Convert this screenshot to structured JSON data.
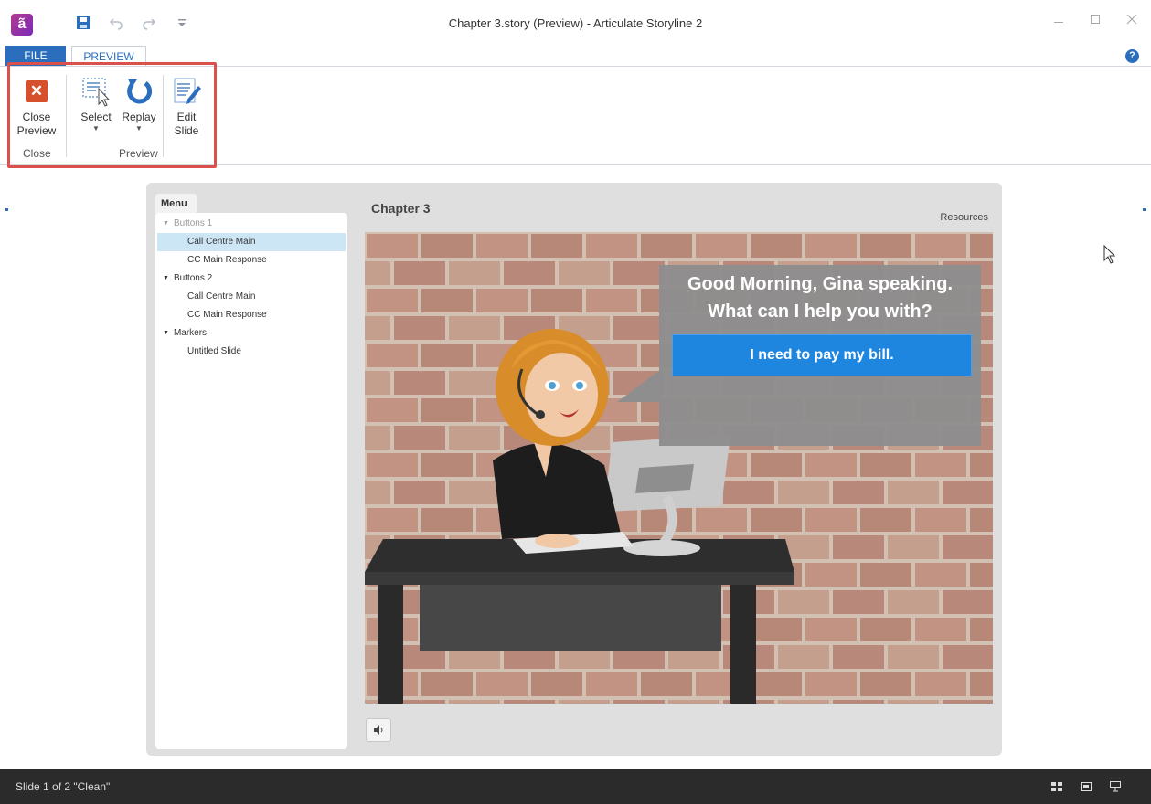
{
  "window": {
    "title": "Chapter 3.story (Preview) -  Articulate Storyline 2",
    "app_icon": "ã"
  },
  "tabs": {
    "file": "FILE",
    "preview": "PREVIEW"
  },
  "ribbon": {
    "close_preview_line1": "Close",
    "close_preview_line2": "Preview",
    "select": "Select",
    "replay": "Replay",
    "edit_line1": "Edit",
    "edit_line2": "Slide",
    "group_close": "Close",
    "group_preview": "Preview"
  },
  "player": {
    "menu_tab": "Menu",
    "chapter_title": "Chapter 3",
    "resources": "Resources",
    "menu": [
      {
        "label": "Buttons 1",
        "kind": "section",
        "dim": true
      },
      {
        "label": "Call Centre Main",
        "kind": "item",
        "active": true
      },
      {
        "label": "CC Main Response",
        "kind": "item"
      },
      {
        "label": "Buttons 2",
        "kind": "section"
      },
      {
        "label": "Call Centre Main",
        "kind": "item"
      },
      {
        "label": "CC Main Response",
        "kind": "item"
      },
      {
        "label": "Markers",
        "kind": "section"
      },
      {
        "label": "Untitled Slide",
        "kind": "item"
      }
    ],
    "bubble_line1": "Good Morning, Gina speaking.",
    "bubble_line2": "What can I help you with?",
    "answer_button": "I need to pay my bill."
  },
  "status": {
    "text": "Slide 1 of 2   \"Clean\"",
    "icons": [
      "grid-view-icon",
      "normal-view-icon",
      "slideshow-icon"
    ]
  },
  "colors": {
    "accent": "#2a6ebd",
    "highlight_box": "#d9504c",
    "answer_button": "#1f86e0",
    "statusbar": "#2b2b2b"
  }
}
